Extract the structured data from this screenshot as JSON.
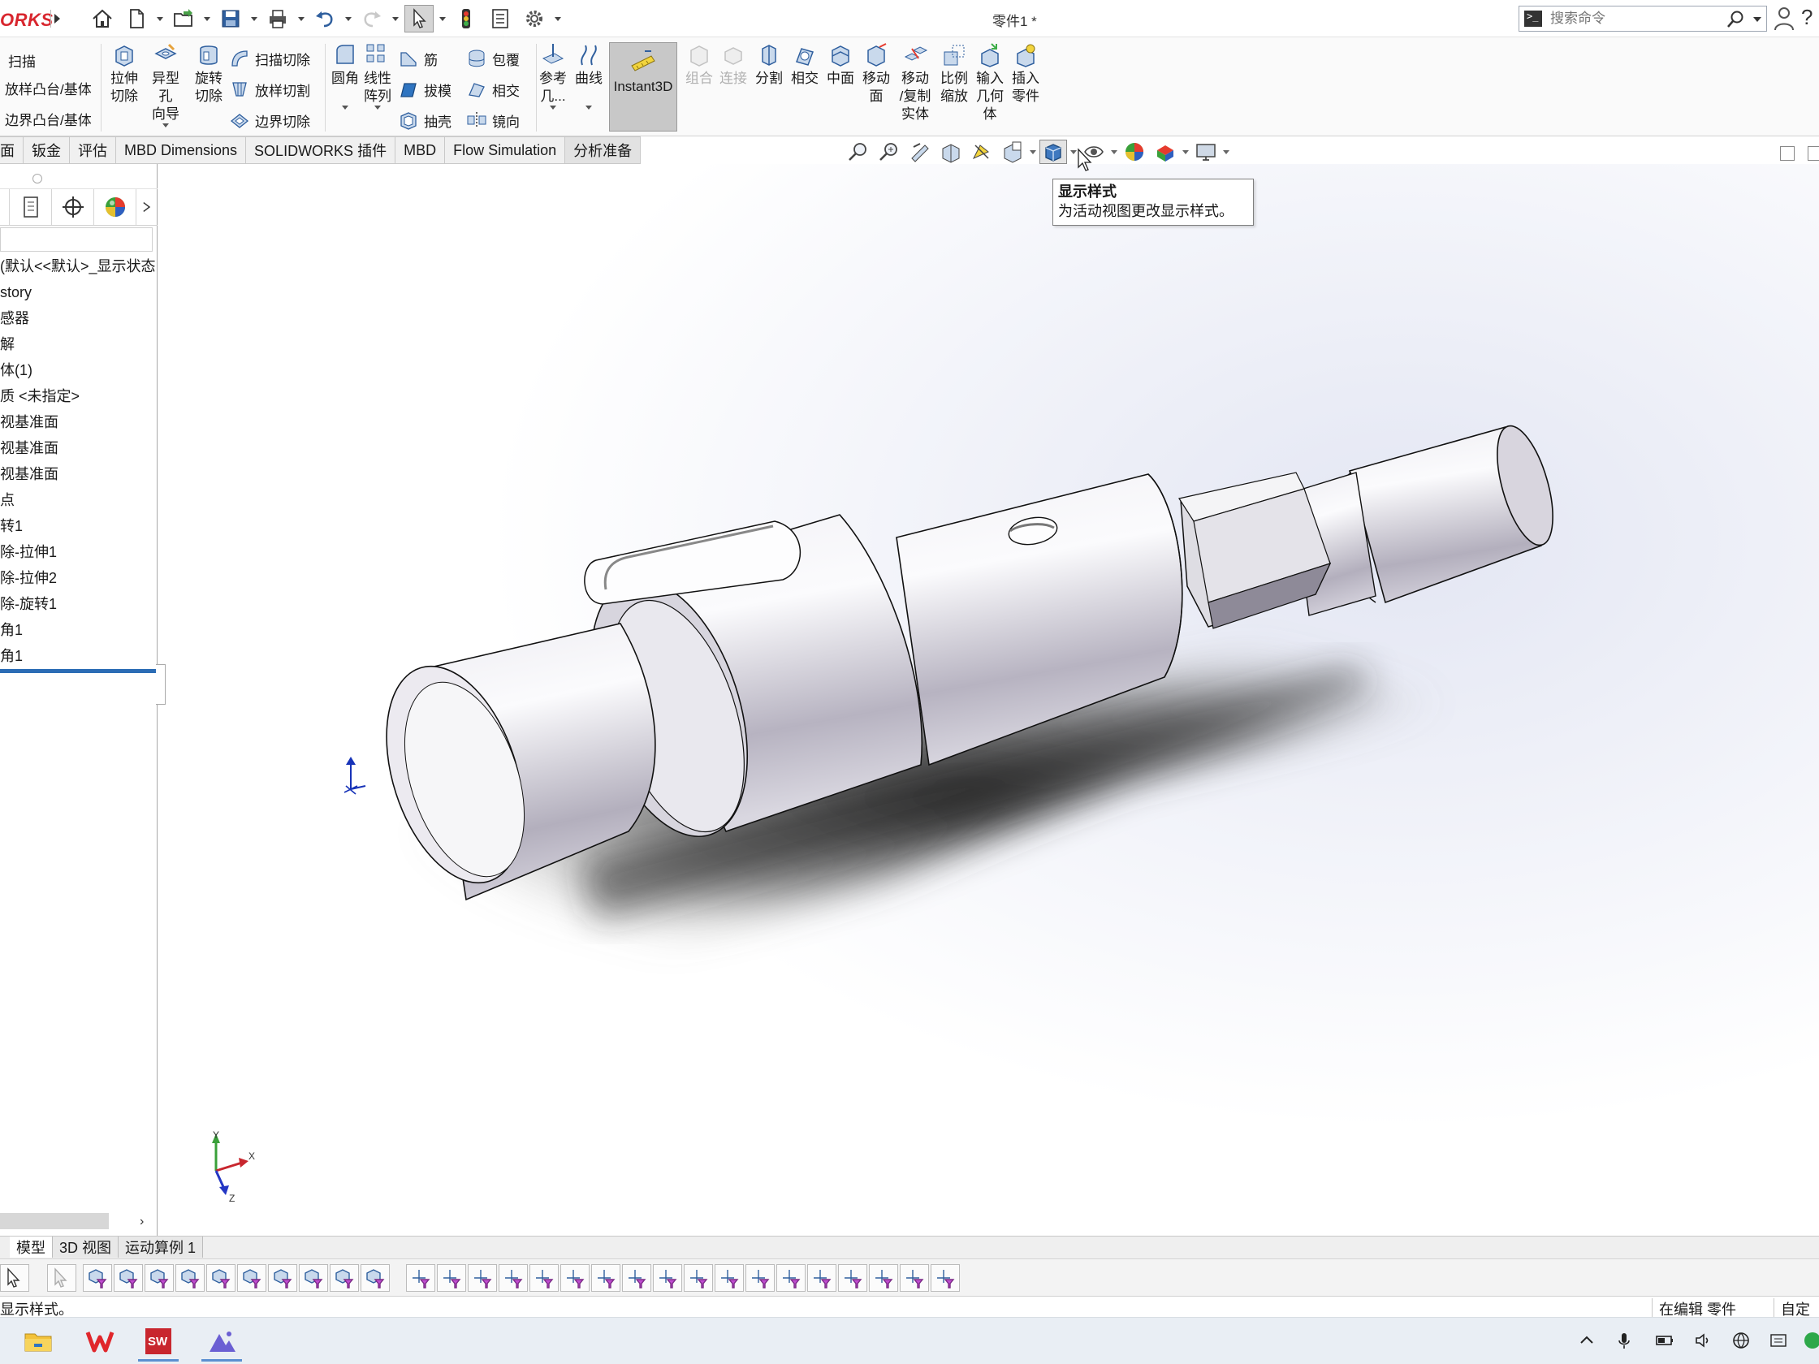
{
  "app": {
    "logo_text": "ORKS",
    "document_title": "零件1 *",
    "search_placeholder": "搜索命令"
  },
  "command_manager": {
    "sweep_boss": "扫描",
    "loft_boss": "放样凸台/基体",
    "boundary_boss": "边界凸台/基体",
    "extruded_cut": [
      "拉伸",
      "切除"
    ],
    "hole_wizard": [
      "异型孔",
      "向导"
    ],
    "revolved_cut": [
      "旋转",
      "切除"
    ],
    "swept_cut": "扫描切除",
    "lofted_cut": "放样切割",
    "boundary_cut": "边界切除",
    "fillet": "圆角",
    "linear_pattern": [
      "线性",
      "阵列"
    ],
    "rib": "筋",
    "draft": "拔模",
    "shell": "抽壳",
    "wrap": "包覆",
    "intersect": "相交",
    "mirror": "镜向",
    "reference_geometry": [
      "参考",
      "几..."
    ],
    "curves": "曲线",
    "instant3d": "Instant3D",
    "combine": "组合",
    "join": "连接",
    "split": "分割",
    "intersect2": "相交",
    "midsurface": "中面",
    "move_face": [
      "移动",
      "面"
    ],
    "move_copy_body": [
      "移动",
      "/复制",
      "实体"
    ],
    "scale": [
      "比例",
      "缩放"
    ],
    "import_geometry": [
      "输入",
      "几何",
      "体"
    ],
    "insert_part": [
      "插入",
      "零件"
    ]
  },
  "tabs": [
    "面",
    "钣金",
    "评估",
    "MBD Dimensions",
    "SOLIDWORKS 插件",
    "MBD",
    "Flow Simulation",
    "分析准备"
  ],
  "tooltip": {
    "title": "显示样式",
    "body": "为活动视图更改显示样式。"
  },
  "feature_tree": [
    "(默认<<默认>_显示状态",
    "story",
    "感器",
    "解",
    "体(1)",
    "质 <未指定>",
    "视基准面",
    "视基准面",
    "视基准面",
    "点",
    "转1",
    "除-拉伸1",
    "除-拉伸2",
    "除-旋转1",
    "角1",
    "角1"
  ],
  "triad_labels": {
    "x": "X",
    "y": "Y",
    "z": "Z"
  },
  "bottom_tabs": [
    "模型",
    "3D 视图",
    "运动算例 1"
  ],
  "status": {
    "message": "显示样式。",
    "mode": "在编辑 零件",
    "custom": "自定义"
  },
  "colors": {
    "part_body": "#dcdbe3",
    "tab_active": "#e2e2e2",
    "rollback_bar": "#2b6cb5",
    "logo_red": "#d8262e"
  }
}
